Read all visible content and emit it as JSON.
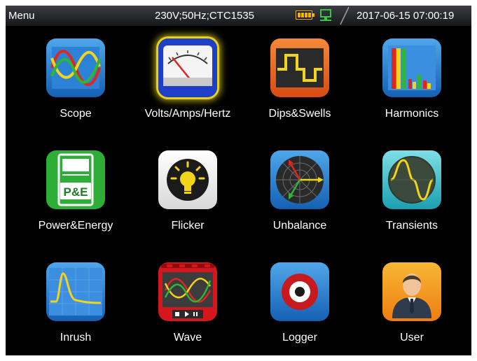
{
  "status_bar": {
    "title": "Menu",
    "supply_info": "230V;50Hz;CTC1535",
    "datetime": "2017-06-15 07:00:19",
    "battery_icon": "battery-icon",
    "network_icon": "network-icon"
  },
  "menu": {
    "selected": "Volts/Amps/Hertz",
    "items": [
      {
        "label": "Scope",
        "icon": "scope-icon"
      },
      {
        "label": "Volts/Amps/Hertz",
        "icon": "meter-icon"
      },
      {
        "label": "Dips&Swells",
        "icon": "dips-swells-icon"
      },
      {
        "label": "Harmonics",
        "icon": "harmonics-icon"
      },
      {
        "label": "Power&Energy",
        "icon": "power-energy-icon",
        "icon_text": "P&E"
      },
      {
        "label": "Flicker",
        "icon": "flicker-bulb-icon"
      },
      {
        "label": "Unbalance",
        "icon": "unbalance-vector-icon"
      },
      {
        "label": "Transients",
        "icon": "transients-icon"
      },
      {
        "label": "Inrush",
        "icon": "inrush-icon"
      },
      {
        "label": "Wave",
        "icon": "wave-icon"
      },
      {
        "label": "Logger",
        "icon": "logger-record-icon"
      },
      {
        "label": "User",
        "icon": "user-icon"
      }
    ]
  },
  "colors": {
    "background": "#000000",
    "selection_glow": "#e7d21a",
    "status_bar": "#2a2c30",
    "phase_red": "#e0261f",
    "phase_yellow": "#f2d51b",
    "phase_green": "#2fb53a"
  }
}
